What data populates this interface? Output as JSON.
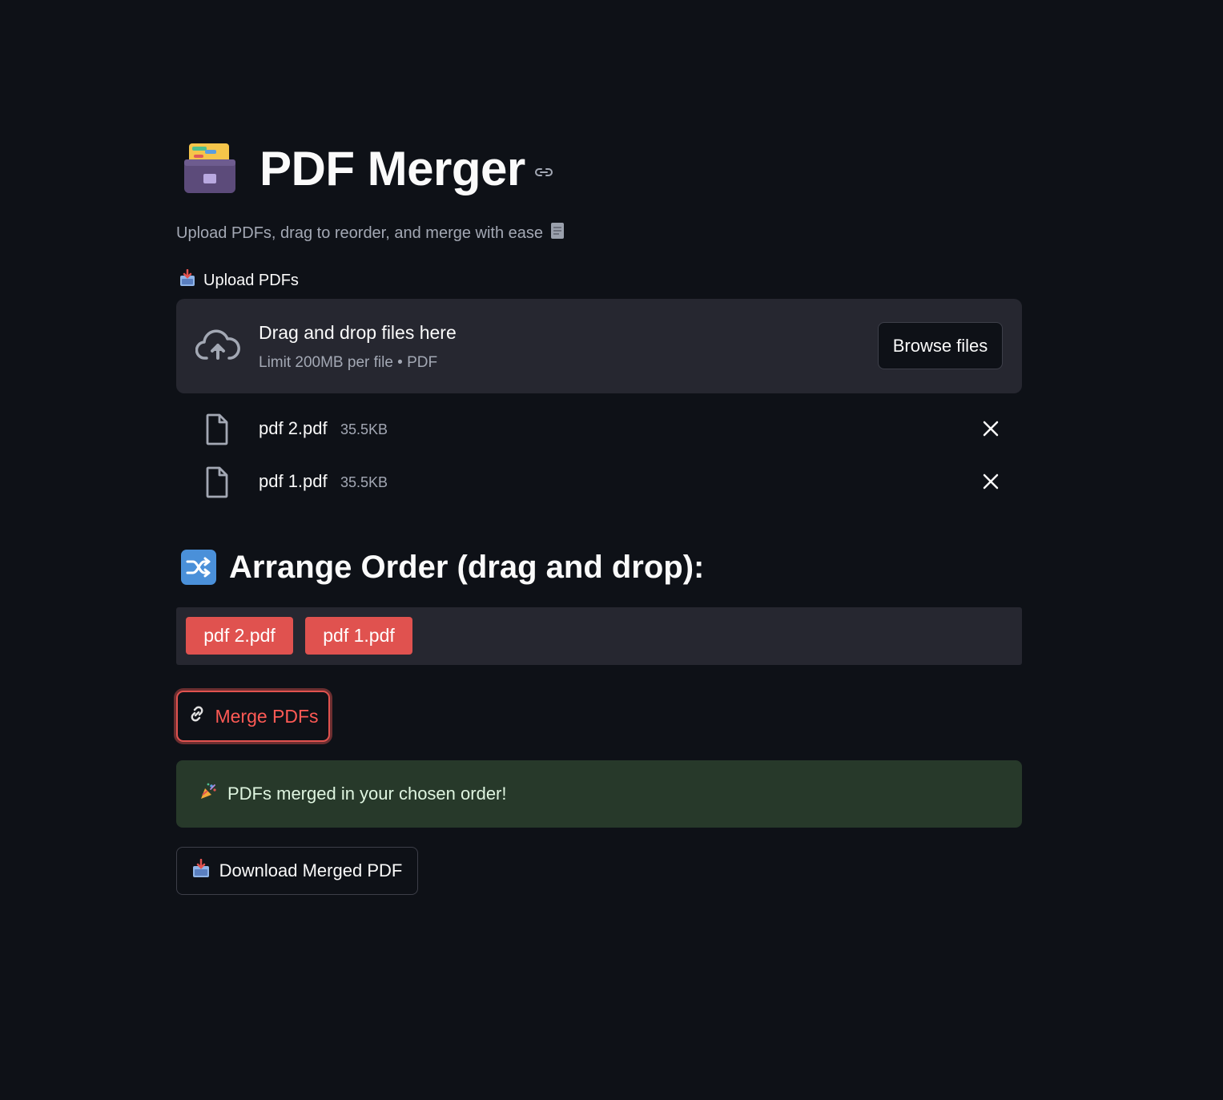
{
  "header": {
    "title": "PDF Merger",
    "title_icon": "card-file-box-icon",
    "subtitle": "Upload PDFs, drag to reorder, and merge with ease"
  },
  "uploader": {
    "label": "Upload PDFs",
    "label_icon": "inbox-tray-icon",
    "drop_title": "Drag and drop files here",
    "drop_limit": "Limit 200MB per file • PDF",
    "browse_label": "Browse files"
  },
  "files": [
    {
      "name": "pdf 2.pdf",
      "size": "35.5KB"
    },
    {
      "name": "pdf 1.pdf",
      "size": "35.5KB"
    }
  ],
  "arrange": {
    "heading": "Arrange Order (drag and drop):",
    "heading_icon": "shuffle-icon",
    "items": [
      "pdf 2.pdf",
      "pdf 1.pdf"
    ]
  },
  "actions": {
    "merge_label": "Merge PDFs",
    "merge_icon": "link-icon",
    "success_message": "PDFs merged in your chosen order!",
    "success_icon": "party-popper-icon",
    "download_label": "Download Merged PDF",
    "download_icon": "inbox-tray-icon"
  },
  "colors": {
    "background": "#0e1117",
    "surface": "#262730",
    "accent": "#e0524f",
    "success_bg": "#27392a",
    "muted_text": "#a3a8b4"
  }
}
